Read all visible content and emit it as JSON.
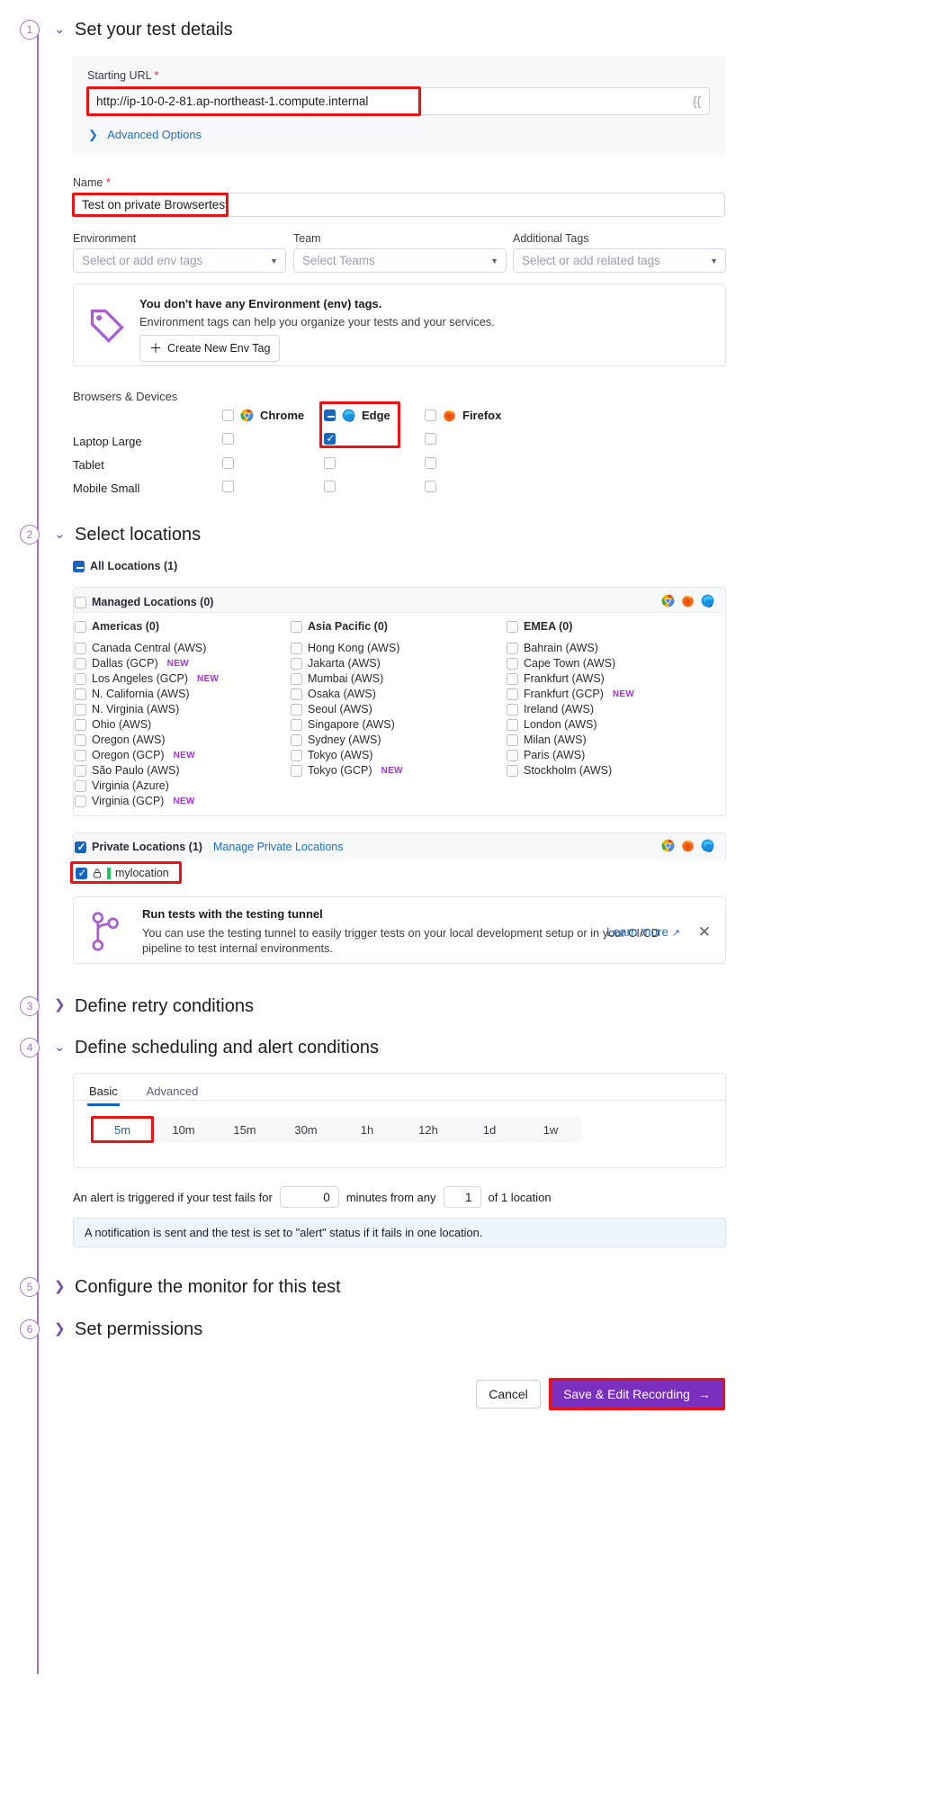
{
  "sections": [
    {
      "num": "1",
      "title": "Set your test details",
      "expanded": true
    },
    {
      "num": "2",
      "title": "Select locations",
      "expanded": true
    },
    {
      "num": "3",
      "title": "Define retry conditions",
      "expanded": false
    },
    {
      "num": "4",
      "title": "Define scheduling and alert conditions",
      "expanded": true
    },
    {
      "num": "5",
      "title": "Configure the monitor for this test",
      "expanded": false
    },
    {
      "num": "6",
      "title": "Set permissions",
      "expanded": false
    }
  ],
  "test_details": {
    "starting_url_label": "Starting URL",
    "starting_url_value": "http://ip-10-0-2-81.ap-northeast-1.compute.internal",
    "variable_hint": "{{",
    "advanced_options": "Advanced Options",
    "name_label": "Name",
    "name_value": "Test on private Browsertest",
    "environment_label": "Environment",
    "environment_placeholder": "Select or add env tags",
    "team_label": "Team",
    "team_placeholder": "Select Teams",
    "tags_label": "Additional Tags",
    "tags_placeholder": "Select or add related tags",
    "env_callout": {
      "title": "You don't have any Environment (env) tags.",
      "body": "Environment tags can help you organize your tests and your services.",
      "button": "Create New Env Tag"
    },
    "browsers_label": "Browsers & Devices",
    "browsers": [
      {
        "name": "Chrome",
        "state": "unchecked"
      },
      {
        "name": "Edge",
        "state": "indeterminate"
      },
      {
        "name": "Firefox",
        "state": "unchecked"
      }
    ],
    "devices": [
      {
        "name": "Laptop Large",
        "cells": [
          "unchecked",
          "checked",
          "unchecked"
        ]
      },
      {
        "name": "Tablet",
        "cells": [
          "unchecked",
          "unchecked",
          "unchecked"
        ]
      },
      {
        "name": "Mobile Small",
        "cells": [
          "unchecked",
          "unchecked",
          "unchecked"
        ]
      }
    ]
  },
  "locations": {
    "all_locations": "All Locations (1)",
    "managed_locations": "Managed Locations (0)",
    "groups": [
      {
        "header": "Americas (0)",
        "items": [
          {
            "label": "Canada Central (AWS)",
            "new": false
          },
          {
            "label": "Dallas (GCP)",
            "new": true
          },
          {
            "label": "Los Angeles (GCP)",
            "new": true
          },
          {
            "label": "N. California (AWS)",
            "new": false
          },
          {
            "label": "N. Virginia (AWS)",
            "new": false
          },
          {
            "label": "Ohio (AWS)",
            "new": false
          },
          {
            "label": "Oregon (AWS)",
            "new": false
          },
          {
            "label": "Oregon (GCP)",
            "new": true
          },
          {
            "label": "São Paulo (AWS)",
            "new": false
          },
          {
            "label": "Virginia (Azure)",
            "new": false
          },
          {
            "label": "Virginia (GCP)",
            "new": true
          }
        ]
      },
      {
        "header": "Asia Pacific (0)",
        "items": [
          {
            "label": "Hong Kong (AWS)",
            "new": false
          },
          {
            "label": "Jakarta (AWS)",
            "new": false
          },
          {
            "label": "Mumbai (AWS)",
            "new": false
          },
          {
            "label": "Osaka (AWS)",
            "new": false
          },
          {
            "label": "Seoul (AWS)",
            "new": false
          },
          {
            "label": "Singapore (AWS)",
            "new": false
          },
          {
            "label": "Sydney (AWS)",
            "new": false
          },
          {
            "label": "Tokyo (AWS)",
            "new": false
          },
          {
            "label": "Tokyo (GCP)",
            "new": true
          }
        ]
      },
      {
        "header": "EMEA (0)",
        "items": [
          {
            "label": "Bahrain (AWS)",
            "new": false
          },
          {
            "label": "Cape Town (AWS)",
            "new": false
          },
          {
            "label": "Frankfurt (AWS)",
            "new": false
          },
          {
            "label": "Frankfurt (GCP)",
            "new": true
          },
          {
            "label": "Ireland (AWS)",
            "new": false
          },
          {
            "label": "London (AWS)",
            "new": false
          },
          {
            "label": "Milan (AWS)",
            "new": false
          },
          {
            "label": "Paris (AWS)",
            "new": false
          },
          {
            "label": "Stockholm (AWS)",
            "new": false
          }
        ]
      }
    ],
    "private_locations": "Private Locations (1)",
    "manage_private_locations": "Manage Private Locations",
    "private_item": "mylocation",
    "tunnel_callout": {
      "title": "Run tests with the testing tunnel",
      "body": "You can use the testing tunnel to easily trigger tests on your local development setup or in your CI/CD pipeline to test internal environments.",
      "learn_more": "Learn more"
    }
  },
  "scheduling": {
    "tabs": [
      {
        "label": "Basic",
        "active": true
      },
      {
        "label": "Advanced",
        "active": false
      }
    ],
    "frequencies": [
      "5m",
      "10m",
      "15m",
      "30m",
      "1h",
      "12h",
      "1d",
      "1w"
    ],
    "selected_frequency": "5m",
    "alert_prefix": "An alert is triggered if your test fails for",
    "alert_minutes_value": "0",
    "alert_middle": "minutes from any",
    "alert_locations_value": "1",
    "alert_suffix": "of 1 location",
    "notification_note": "A notification is sent and the test is set to \"alert\" status if it fails in one location."
  },
  "footer": {
    "cancel": "Cancel",
    "save": "Save & Edit Recording"
  },
  "colors": {
    "accent_purple": "#a972c8",
    "brand_purple": "#7a2fbf",
    "blue": "#1566c0",
    "new_badge": "#a333e0",
    "highlight_red": "#ee1111"
  }
}
